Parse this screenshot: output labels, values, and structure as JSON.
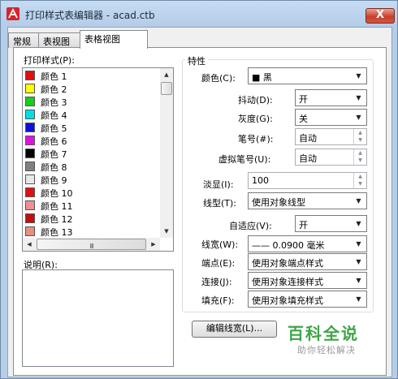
{
  "window": {
    "title": "打印样式表编辑器 - acad.ctb",
    "close_label": "X"
  },
  "tabs": [
    {
      "label": "常规"
    },
    {
      "label": "表视图"
    },
    {
      "label": "表格视图",
      "active": true
    }
  ],
  "styles_list": {
    "label": "打印样式(P):",
    "items": [
      {
        "label": "颜色  1",
        "color": "#e01010"
      },
      {
        "label": "颜色  2",
        "color": "#ffff00"
      },
      {
        "label": "颜色  3",
        "color": "#18d018"
      },
      {
        "label": "颜色  4",
        "color": "#00e0e0"
      },
      {
        "label": "颜色  5",
        "color": "#1010d8"
      },
      {
        "label": "颜色  6",
        "color": "#e010e0"
      },
      {
        "label": "颜色  7",
        "color": "#000000"
      },
      {
        "label": "颜色  8",
        "color": "#808080"
      },
      {
        "label": "颜色  9",
        "color": "#e8e8e8"
      },
      {
        "label": "颜色  10",
        "color": "#e01010"
      },
      {
        "label": "颜色  11",
        "color": "#f09090"
      },
      {
        "label": "颜色  12",
        "color": "#c01010"
      },
      {
        "label": "颜色  13",
        "color": "#e89080"
      }
    ],
    "hscroll_grip": "III"
  },
  "description": {
    "label": "说明(R):"
  },
  "properties": {
    "group_title": "特性",
    "color": {
      "label": "颜色(C):",
      "value": "■ 黑"
    },
    "dither": {
      "label": "抖动(D):",
      "value": "开"
    },
    "grayscale": {
      "label": "灰度(G):",
      "value": "关"
    },
    "pen": {
      "label": "笔号(#):",
      "value": "自动"
    },
    "virtual_pen": {
      "label": "虚拟笔号(U):",
      "value": "自动"
    },
    "screening": {
      "label": "淡显(I):",
      "value": "100"
    },
    "linetype": {
      "label": "线型(T):",
      "value": "使用对象线型"
    },
    "adaptive": {
      "label": "自适应(V):",
      "value": "开"
    },
    "lineweight": {
      "label": "线宽(W):",
      "value": "—— 0.0900 毫米"
    },
    "line_end": {
      "label": "端点(E):",
      "value": "使用对象端点样式"
    },
    "line_join": {
      "label": "连接(J):",
      "value": "使用对象连接样式"
    },
    "fill": {
      "label": "填充(F):",
      "value": "使用对象填充样式"
    },
    "edit_lineweights": {
      "label": "编辑线宽(L)..."
    }
  },
  "watermark": {
    "main": "百科全说",
    "sub": "助你轻松解决"
  },
  "accent_colors": {
    "watermark_green": "#3fa547",
    "close_red": "#c8402a"
  }
}
